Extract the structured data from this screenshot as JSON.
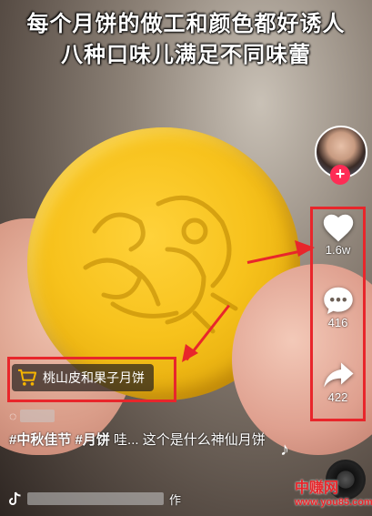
{
  "video": {
    "caption_line1": "每个月饼的做工和颜色都好诱人",
    "caption_line2": "八种口味儿满足不同味蕾"
  },
  "actions": {
    "like_count": "1.6w",
    "comment_count": "416",
    "share_count": "422"
  },
  "product_tag": {
    "label": "桃山皮和果子月饼",
    "icon": "shopping-cart-icon"
  },
  "description": {
    "hashtag1": "#中秋佳节",
    "hashtag2": "#月饼",
    "text": "哇... 这个是什么神仙月饼"
  },
  "music": {
    "suffix": "作",
    "icon": "tiktok-logo-icon"
  },
  "watermark": {
    "brand": "中赚网",
    "url": "www.you85.com"
  },
  "colors": {
    "annotation_red": "#e8262b",
    "follow_pink": "#fe2c55"
  }
}
